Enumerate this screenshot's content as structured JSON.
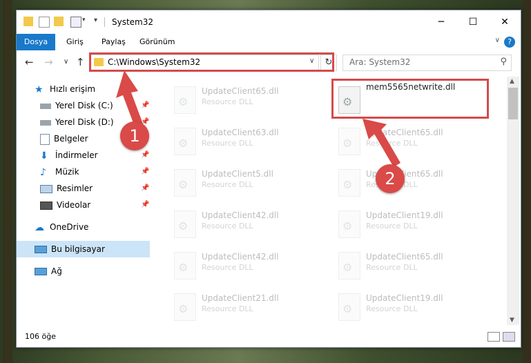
{
  "window": {
    "title": "System32",
    "controls": {
      "minimize": "─",
      "maximize": "☐",
      "close": "✕"
    }
  },
  "ribbon": {
    "tabs": [
      {
        "label": "Dosya",
        "active": true
      },
      {
        "label": "Giriş",
        "active": false
      },
      {
        "label": "Paylaş",
        "active": false
      },
      {
        "label": "Görünüm",
        "active": false
      }
    ],
    "help": "?"
  },
  "nav": {
    "address": "C:\\Windows\\System32",
    "search_placeholder": "Ara: System32"
  },
  "sidebar": {
    "items": [
      {
        "label": "Hızlı erişim",
        "icon": "star-icon",
        "pinned": false
      },
      {
        "label": "Yerel Disk (C:)",
        "icon": "drive-icon",
        "pinned": true
      },
      {
        "label": "Yerel Disk (D:)",
        "icon": "drive-icon",
        "pinned": true
      },
      {
        "label": "Belgeler",
        "icon": "document-icon",
        "pinned": true
      },
      {
        "label": "İndirmeler",
        "icon": "download-icon",
        "pinned": true
      },
      {
        "label": "Müzik",
        "icon": "music-icon",
        "pinned": true
      },
      {
        "label": "Resimler",
        "icon": "pictures-icon",
        "pinned": true
      },
      {
        "label": "Videolar",
        "icon": "video-icon",
        "pinned": true
      },
      {
        "label": "OneDrive",
        "icon": "cloud-icon",
        "pinned": false
      },
      {
        "label": "Bu bilgisayar",
        "icon": "computer-icon",
        "pinned": false,
        "selected": true
      },
      {
        "label": "Ağ",
        "icon": "network-icon",
        "pinned": false
      }
    ]
  },
  "files": {
    "left": [
      {
        "name": "UpdateClient65.dll",
        "type": "Resource DLL"
      },
      {
        "name": "UpdateClient63.dll",
        "type": "Resource DLL"
      },
      {
        "name": "UpdateClient5.dll",
        "type": "Resource DLL"
      },
      {
        "name": "UpdateClient42.dll",
        "type": "Resource DLL"
      },
      {
        "name": "UpdateClient42.dll",
        "type": "Resource DLL"
      },
      {
        "name": "UpdateClient21.dll",
        "type": "Resource DLL"
      }
    ],
    "right": [
      {
        "name": "mem5565netwrite.dll",
        "type": ""
      },
      {
        "name": "UpdateClient65.dll",
        "type": "Resource DLL"
      },
      {
        "name": "UpdateClient65.dll",
        "type": "Resource DLL"
      },
      {
        "name": "UpdateClient19.dll",
        "type": "Resource DLL"
      },
      {
        "name": "UpdateClient65.dll",
        "type": "Resource DLL"
      },
      {
        "name": "UpdateClient19.dll",
        "type": "Resource DLL"
      }
    ]
  },
  "status": {
    "item_count": "106 öğe"
  },
  "annotations": {
    "step1": "1",
    "step2": "2",
    "color": "#d44b4b"
  }
}
